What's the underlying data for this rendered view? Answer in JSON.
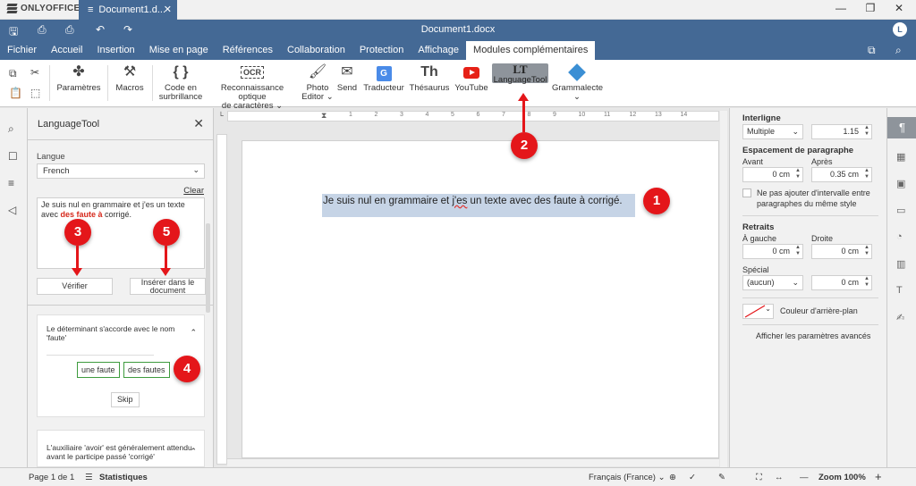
{
  "app": {
    "brand": "ONLYOFFICE",
    "tab_title": "Document1.d...",
    "doc_title": "Document1.docx",
    "avatar_letter": "L"
  },
  "menu": [
    "Fichier",
    "Accueil",
    "Insertion",
    "Mise en page",
    "Références",
    "Collaboration",
    "Protection",
    "Affichage",
    "Modules complémentaires"
  ],
  "toolbar": {
    "parametres": "Paramètres",
    "macros": "Macros",
    "code_line1": "Code en",
    "code_line2": "surbrillance",
    "ocr_line1": "Reconnaissance optique",
    "ocr_line2": "de caractères",
    "ocr_icon": "OCR",
    "photo_line1": "Photo",
    "photo_line2": "Editor",
    "send": "Send",
    "traducteur": "Traducteur",
    "thesaurus": "Thésaurus",
    "thesaurus_icon": "Th",
    "youtube": "YouTube",
    "languagetool": "LanguageTool",
    "languagetool_icon": "LT",
    "grammalecte": "Grammalecte",
    "code_icon": "{ }"
  },
  "panel": {
    "title": "LanguageTool",
    "lang_label": "Langue",
    "lang_value": "French",
    "clear": "Clear",
    "text_a": "Je suis nul en grammaire et j'es un texte avec ",
    "text_err": "des faute à",
    "text_b": " corrigé.",
    "verify": "Vérifier",
    "insert_line1": "Insérer dans le",
    "insert_line2": "document",
    "card1_msg": "Le déterminant s'accorde avec le nom 'faute'",
    "sugg1": "une faute",
    "sugg2": "des fautes",
    "skip": "Skip",
    "card2_msg": "L'auxiliaire 'avoir' est généralement attendu avant le participe passé 'corrigé'"
  },
  "document": {
    "text_a": "Je suis nul en grammaire et ",
    "text_squig": "j'es",
    "text_b": " un texte avec des faute à corrigé."
  },
  "right": {
    "interligne": "Interligne",
    "interligne_mode": "Multiple",
    "interligne_value": "1.15",
    "espacement": "Espacement de paragraphe",
    "avant": "Avant",
    "apres": "Après",
    "avant_value": "0 cm",
    "apres_value": "0.35 cm",
    "checkbox_label_1": "Ne pas ajouter d'intervalle entre",
    "checkbox_label_2": "paragraphes du même style",
    "retraits": "Retraits",
    "gauche": "À gauche",
    "droite": "Droite",
    "gauche_value": "0 cm",
    "droite_value": "0 cm",
    "special": "Spécial",
    "special_value": "(aucun)",
    "special_cm": "0 cm",
    "couleur": "Couleur d'arrière-plan",
    "avances": "Afficher les paramètres avancés"
  },
  "status": {
    "page": "Page 1 de 1",
    "stats": "Statistiques",
    "lang": "Français (France)",
    "zoom": "Zoom 100%"
  },
  "badges": {
    "b1": "1",
    "b2": "2",
    "b3": "3",
    "b4": "4",
    "b5": "5"
  },
  "ruler_ticks": [
    1,
    2,
    3,
    4,
    5,
    6,
    7,
    8,
    9,
    10,
    11,
    12,
    13,
    14
  ]
}
